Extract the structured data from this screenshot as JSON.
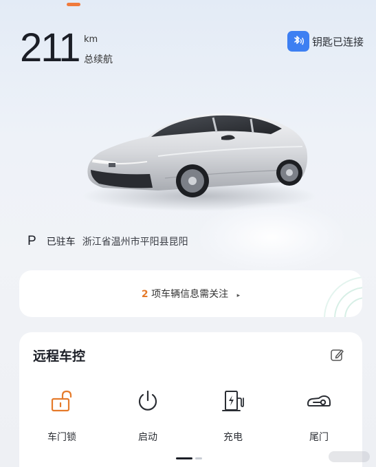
{
  "range": {
    "value": "211",
    "unit": "km",
    "label": "总续航"
  },
  "key_status": {
    "icon": "bluetooth-icon",
    "text": "钥匙已连接",
    "badge_color": "#3d7ff2"
  },
  "vehicle": {
    "image": "silver electric sedan"
  },
  "parking": {
    "gear": "P",
    "status": "已驻车",
    "address": "浙江省温州市平阳县昆阳"
  },
  "alert": {
    "count": "2",
    "text": "项车辆信息需关注",
    "arrow": "▸",
    "count_color": "#e57a2a"
  },
  "remote_control": {
    "title": "远程车控",
    "edit_icon": "edit-icon",
    "items": [
      {
        "label": "车门锁",
        "icon": "unlocked-padlock-icon"
      },
      {
        "label": "启动",
        "icon": "power-icon"
      },
      {
        "label": "充电",
        "icon": "charging-station-icon"
      },
      {
        "label": "尾门",
        "icon": "trunk-car-icon"
      }
    ],
    "accent_color": "#e57a2a"
  },
  "pager": {
    "pages": 2,
    "active": 1
  }
}
